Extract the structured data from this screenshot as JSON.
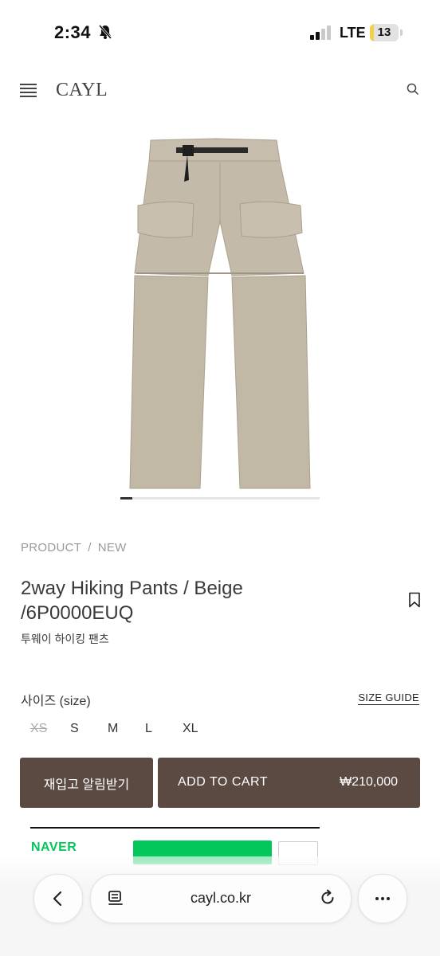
{
  "status_bar": {
    "time": "2:34",
    "network": "LTE",
    "battery_level": "13",
    "battery_fraction": 0.13
  },
  "header": {
    "logo": "CAYL",
    "icons": [
      "menu-icon",
      "search-icon"
    ]
  },
  "gallery": {
    "image_subject": "beige two-way hiking pants",
    "slide_progress": 0.06
  },
  "product": {
    "breadcrumb": [
      "PRODUCT",
      "NEW"
    ],
    "breadcrumb_sep": "/",
    "title_line1": "2way Hiking Pants / Beige",
    "title_line2": "/6P0000EUQ",
    "subtitle": "투웨이 하이킹 팬츠",
    "size_label": "사이즈 (size)",
    "size_guide": "SIZE GUIDE",
    "sizes": [
      {
        "label": "XS",
        "sold_out": true
      },
      {
        "label": "S",
        "sold_out": false
      },
      {
        "label": "M",
        "sold_out": false
      },
      {
        "label": "L",
        "sold_out": false
      },
      {
        "label": "XL",
        "sold_out": false
      }
    ],
    "restock_button": "재입고 알림받기",
    "cart_button": "ADD TO CART",
    "price": "₩210,000"
  },
  "naver": {
    "logo": "NAVER"
  },
  "browser": {
    "url": "cayl.co.kr",
    "icons": [
      "back-icon",
      "reader-icon",
      "reload-icon",
      "more-icon"
    ]
  },
  "colors": {
    "button_brown": "#5a4a42",
    "naver_green": "#03c75a",
    "pants_beige": "#c2b9a8"
  }
}
